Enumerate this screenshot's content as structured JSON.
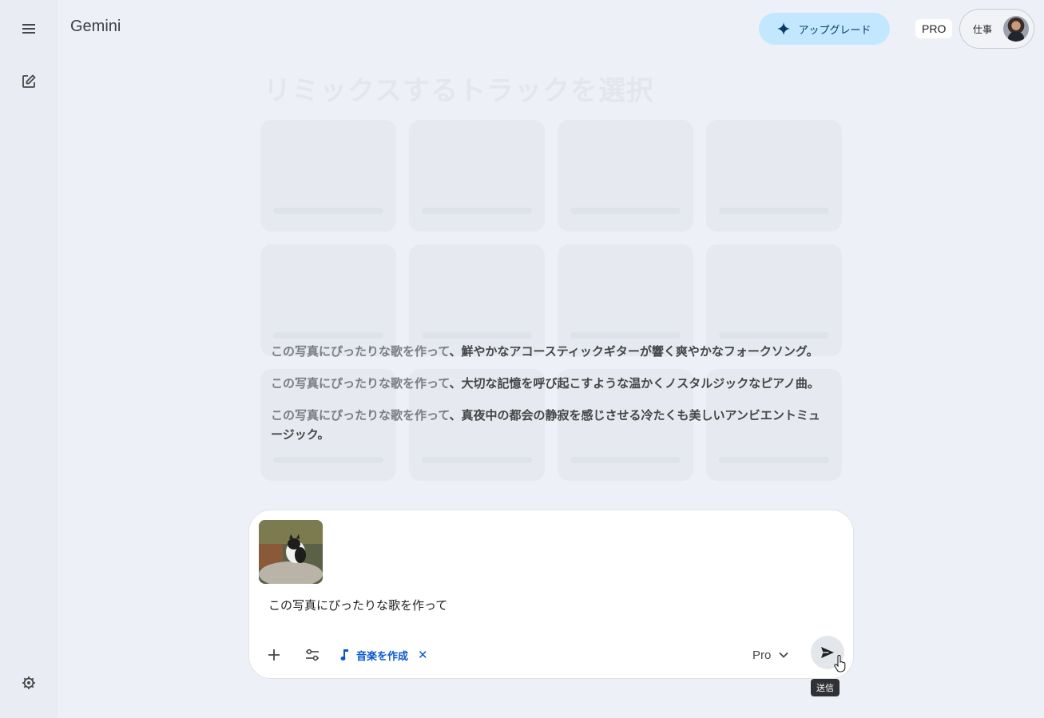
{
  "app": {
    "title": "Gemini"
  },
  "header": {
    "upgrade_label": "アップグレード",
    "pro_badge": "PRO",
    "account_label": "仕事"
  },
  "background": {
    "gallery_title": "リミックスするトラックを選択"
  },
  "suggestions": [
    {
      "prefix": "この写真にぴったりな歌を作って",
      "text": "、鮮やかなアコースティックギターが響く爽やかなフォークソング。"
    },
    {
      "prefix": "この写真にぴったりな歌を作って",
      "text": "、大切な記憶を呼び起こすような温かくノスタルジックなピアノ曲。"
    },
    {
      "prefix": "この写真にぴったりな歌を作って",
      "text": "、真夜中の都会の静寂を感じさせる冷たくも美しいアンビエントミュージック。"
    }
  ],
  "composer": {
    "prompt_text": "この写真にぴったりな歌を作って",
    "tool_chip_label": "音楽を作成",
    "model_label": "Pro",
    "send_tooltip": "送信"
  },
  "colors": {
    "accent": "#0b57d0",
    "upgrade_bg": "#c2e7ff",
    "page_bg": "#edf1f7"
  },
  "icons": {
    "menu": "menu-icon",
    "new_chat": "edit-icon",
    "settings": "gear-icon",
    "sparkle": "sparkle-icon",
    "add": "plus-icon",
    "tools": "tune-icon",
    "music": "music-note-icon",
    "close": "close-icon",
    "dropdown": "chevron-down-icon",
    "send": "send-icon"
  }
}
